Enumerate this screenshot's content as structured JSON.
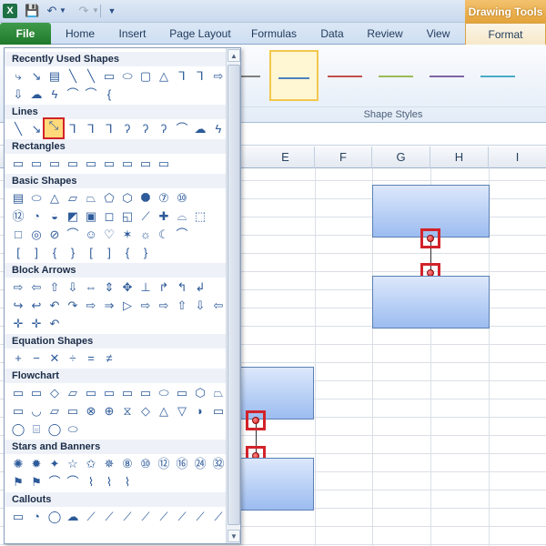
{
  "window": {
    "app_icon_text": "X",
    "quick_access": {
      "save_icon": "save-icon",
      "undo_icon": "undo-icon",
      "redo_icon": "redo-icon",
      "customize_icon": "customize-qat-icon"
    },
    "contextual_tab_group": "Drawing Tools"
  },
  "ribbon": {
    "tabs": [
      {
        "label": "File"
      },
      {
        "label": "Home"
      },
      {
        "label": "Insert"
      },
      {
        "label": "Page Layout"
      },
      {
        "label": "Formulas"
      },
      {
        "label": "Data"
      },
      {
        "label": "Review"
      },
      {
        "label": "View"
      },
      {
        "label": "Format"
      }
    ],
    "active_tab": "Format",
    "shape_styles_label": "Shape Styles",
    "shape_style_colors": [
      "#7f7f7f",
      "#4f81bd",
      "#c0504d",
      "#9bbb59",
      "#8064a2",
      "#4bacc6"
    ],
    "selected_style_index": 1
  },
  "sheet": {
    "columns": [
      "E",
      "F",
      "G",
      "H",
      "I"
    ]
  },
  "shapes_menu": {
    "sections": [
      {
        "title": "Recently Used Shapes"
      },
      {
        "title": "Lines"
      },
      {
        "title": "Rectangles"
      },
      {
        "title": "Basic Shapes"
      },
      {
        "title": "Block Arrows"
      },
      {
        "title": "Equation Shapes"
      },
      {
        "title": "Flowchart"
      },
      {
        "title": "Stars and Banners"
      },
      {
        "title": "Callouts"
      }
    ],
    "selected_shape": "double-arrow-line",
    "scroll_up_icon": "▲",
    "scroll_down_icon": "▼"
  },
  "colors": {
    "selection_highlight": "#d2232a",
    "file_tab": "#1f7a2c",
    "contextual_tab": "#e4a33b",
    "shape_fill": "#9cbcf0"
  }
}
